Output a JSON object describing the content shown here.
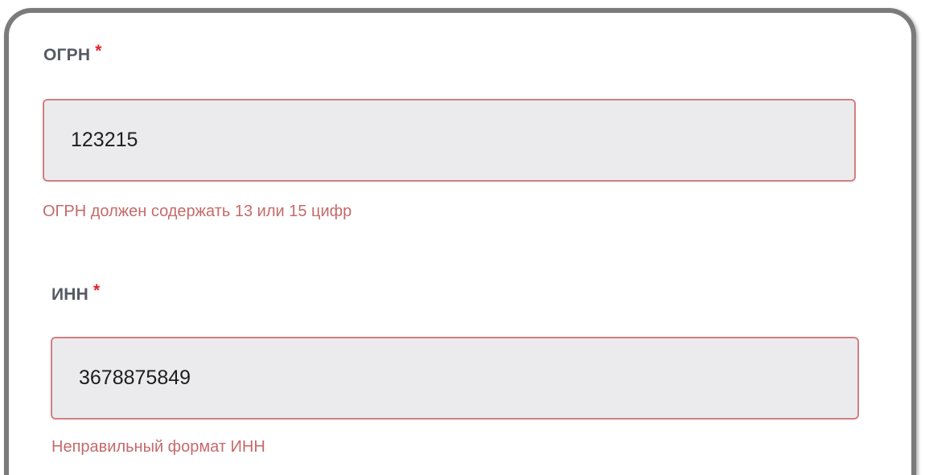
{
  "form": {
    "ogrn": {
      "label": "ОГРН",
      "required_mark": "*",
      "value": "123215",
      "error": "ОГРН должен содержать 13 или 15 цифр"
    },
    "inn": {
      "label": "ИНН",
      "required_mark": "*",
      "value": "3678875849",
      "error": "Неправильный формат ИНН"
    }
  },
  "colors": {
    "frame_border": "#7b7b7b",
    "input_background": "#ebebee",
    "input_error_border": "#d08080",
    "error_text": "#c56a6a",
    "required_mark": "#e3242b",
    "label_text": "#555a64"
  }
}
